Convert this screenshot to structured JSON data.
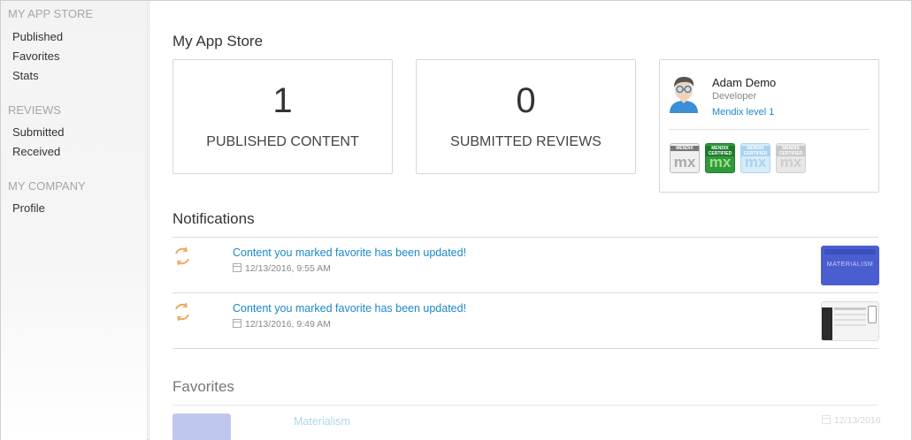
{
  "sidebar": {
    "sections": [
      {
        "heading": "MY APP STORE",
        "items": [
          "Published",
          "Favorites",
          "Stats"
        ]
      },
      {
        "heading": "REVIEWS",
        "items": [
          "Submitted",
          "Received"
        ]
      },
      {
        "heading": "MY COMPANY",
        "items": [
          "Profile"
        ]
      }
    ]
  },
  "page": {
    "title": "My App Store"
  },
  "stats": [
    {
      "value": "1",
      "label": "PUBLISHED CONTENT"
    },
    {
      "value": "0",
      "label": "SUBMITTED REVIEWS"
    }
  ],
  "profile": {
    "name": "Adam Demo",
    "role": "Developer",
    "level": "Mendix level 1",
    "badges": [
      {
        "top": "MENDIX",
        "mark": "mx",
        "state": "outline"
      },
      {
        "top": "MENDIX CERTIFIED",
        "mark": "mx",
        "state": "green"
      },
      {
        "top": "MENDIX CERTIFIED",
        "mark": "mx",
        "state": "light-blue"
      },
      {
        "top": "MENDIX CERTIFIED",
        "mark": "mx",
        "state": "grey"
      }
    ]
  },
  "notifications": {
    "heading": "Notifications",
    "items": [
      {
        "title": "Content you marked favorite has been updated!",
        "date": "12/13/2016, 9:55 AM",
        "thumb_text": "MATERIALISM"
      },
      {
        "title": "Content you marked favorite has been updated!",
        "date": "12/13/2016, 9:49 AM",
        "thumb_text": ""
      }
    ]
  },
  "favorites": {
    "heading": "Favorites",
    "items": [
      {
        "name": "Materialism",
        "date": "12/13/2016"
      }
    ]
  },
  "colors": {
    "link": "#1a88c9",
    "refresh_icon": "#f0a04b",
    "badge_green": "#2e9a3c",
    "thumb_blue": "#4a5ed0"
  }
}
